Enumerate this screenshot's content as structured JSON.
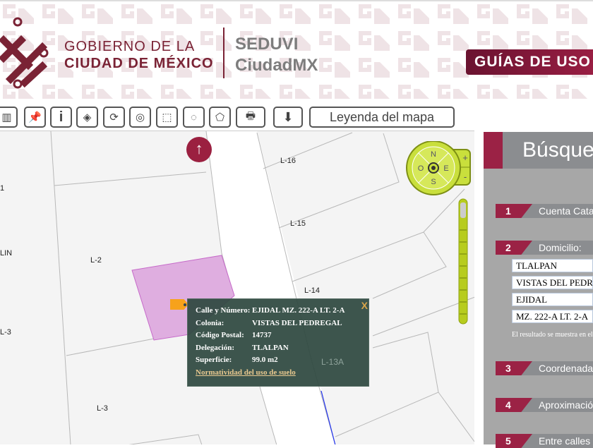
{
  "header": {
    "gov_line1": "GOBIERNO DE LA",
    "gov_line2": "CIUDAD DE MÉXICO",
    "agency_line1": "SEDUVI",
    "agency_line2": "CiudadMX",
    "guides_button": "GUÍAS DE USO"
  },
  "toolbar": {
    "tools": [
      "measure-icon",
      "pushpin-icon",
      "info-icon",
      "layers-icon",
      "refresh-icon",
      "locate-icon",
      "rect-select-icon",
      "circle-select-icon",
      "polygon-select-icon",
      "print-icon",
      "download-icon"
    ],
    "legend_button": "Leyenda del mapa"
  },
  "map": {
    "labels": [
      "1",
      "LIN",
      "L-3",
      "L-2",
      "L-3",
      "L-16",
      "L-15",
      "L-14",
      "L-13A"
    ],
    "compass": {
      "n": "N",
      "s": "S",
      "e": "E",
      "w": "O",
      "zoom_in": "+",
      "zoom_out": "-"
    },
    "popup": {
      "rows": [
        {
          "k": "Calle y Número:",
          "v": "EJIDAL MZ. 222-A LT. 2-A"
        },
        {
          "k": "Colonia:",
          "v": "VISTAS DEL PEDREGAL"
        },
        {
          "k": "Código Postal:",
          "v": "14737"
        },
        {
          "k": "Delegación:",
          "v": "TLALPAN"
        },
        {
          "k": "Superficie:",
          "v": "99.0 m2"
        }
      ],
      "link": "Normatividad del uso de suelo",
      "close": "X"
    }
  },
  "panel": {
    "title": "Búsqueda",
    "steps": [
      {
        "n": "1",
        "label": "Cuenta Catastral"
      },
      {
        "n": "2",
        "label": "Domicilio:"
      },
      {
        "n": "3",
        "label": "Coordenadas"
      },
      {
        "n": "4",
        "label": "Aproximación"
      },
      {
        "n": "5",
        "label": "Entre calles"
      }
    ],
    "fields": [
      "TLALPAN",
      "VISTAS DEL PEDREGAL",
      "EJIDAL",
      "MZ. 222-A LT. 2-A"
    ],
    "note": "El resultado se muestra en el mapa"
  },
  "colors": {
    "brand": "#9b2245",
    "popup": "#2e4840",
    "parcel": "#dfaee0"
  }
}
